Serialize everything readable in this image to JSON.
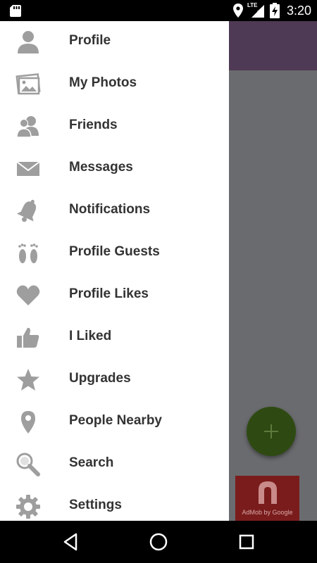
{
  "status_bar": {
    "time": "3:20",
    "network_label": "LTE",
    "icons": [
      "sd-card-icon",
      "location-icon",
      "signal-icon",
      "battery-charging-icon"
    ]
  },
  "drawer": {
    "items": [
      {
        "label": "Profile",
        "icon": "person-icon"
      },
      {
        "label": "My Photos",
        "icon": "photos-icon"
      },
      {
        "label": "Friends",
        "icon": "friends-icon"
      },
      {
        "label": "Messages",
        "icon": "envelope-icon"
      },
      {
        "label": "Notifications",
        "icon": "bell-icon"
      },
      {
        "label": "Profile Guests",
        "icon": "footprints-icon"
      },
      {
        "label": "Profile Likes",
        "icon": "heart-icon"
      },
      {
        "label": "I Liked",
        "icon": "thumbs-up-icon"
      },
      {
        "label": "Upgrades",
        "icon": "star-icon"
      },
      {
        "label": "People Nearby",
        "icon": "map-pin-icon"
      },
      {
        "label": "Search",
        "icon": "search-icon"
      },
      {
        "label": "Settings",
        "icon": "gear-icon"
      }
    ]
  },
  "ad": {
    "text": "AdMob by Google"
  },
  "colors": {
    "toolbar": "#4f3a55",
    "scrim": "#6a6b6e",
    "fab": "#2e4a12",
    "icon_gray": "#9e9e9e",
    "label_text": "#333333"
  },
  "nav_bar": {
    "buttons": [
      "back-icon",
      "home-icon",
      "recents-icon"
    ]
  }
}
